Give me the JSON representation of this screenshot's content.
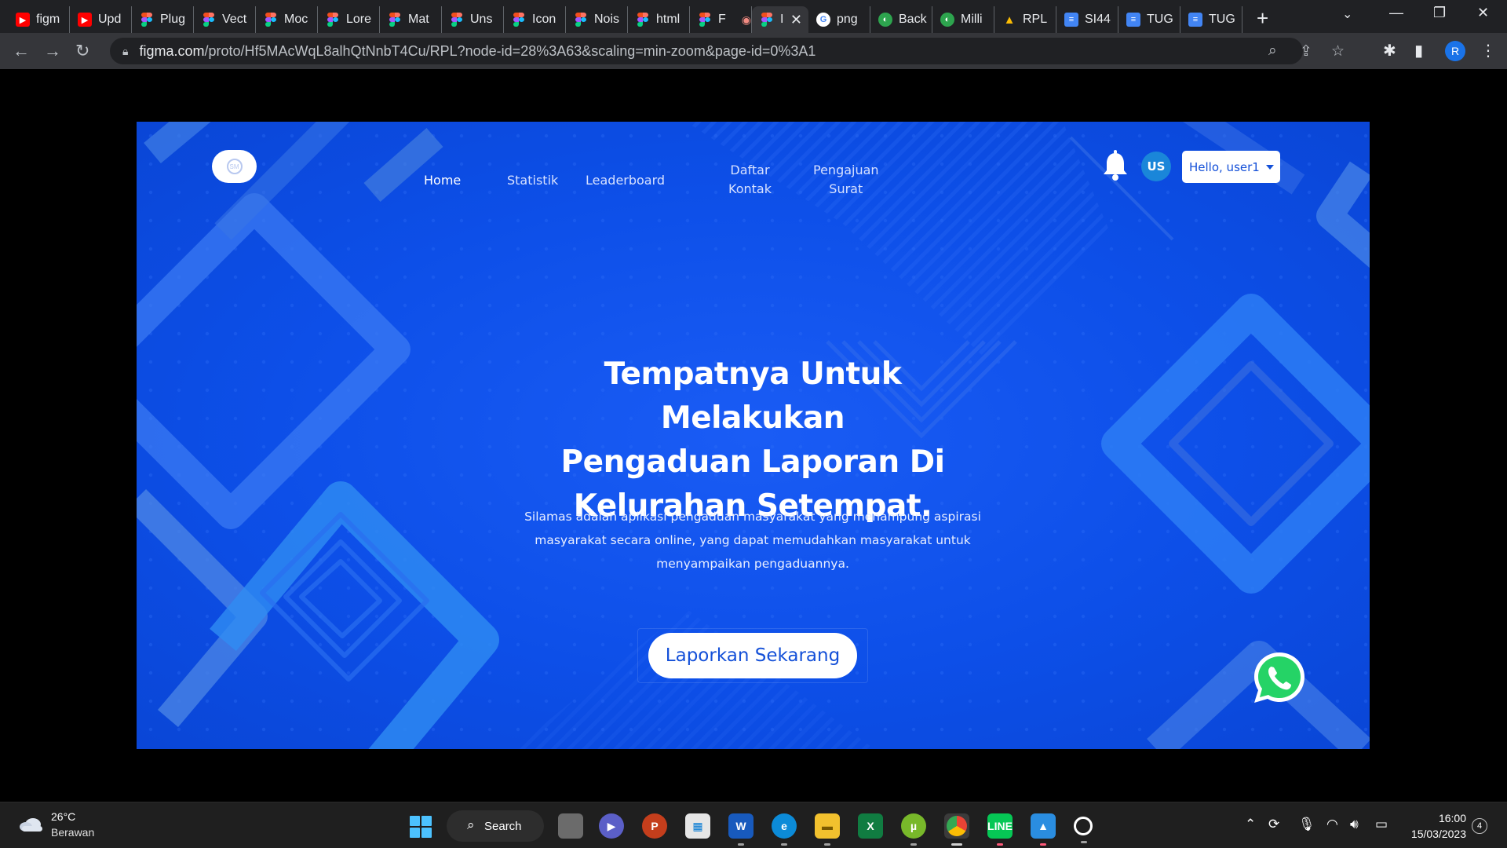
{
  "browser": {
    "tabs": [
      {
        "title": "figm",
        "icon": "youtube-icon"
      },
      {
        "title": "Upd",
        "icon": "youtube-studio-icon"
      },
      {
        "title": "Plug",
        "icon": "figma-icon"
      },
      {
        "title": "Vect",
        "icon": "figma-icon"
      },
      {
        "title": "Moc",
        "icon": "figma-icon"
      },
      {
        "title": "Lore",
        "icon": "figma-icon"
      },
      {
        "title": "Mat",
        "icon": "figma-icon"
      },
      {
        "title": "Uns",
        "icon": "figma-icon"
      },
      {
        "title": "Icon",
        "icon": "figma-icon"
      },
      {
        "title": "Nois",
        "icon": "figma-icon"
      },
      {
        "title": "html",
        "icon": "figma-icon"
      },
      {
        "title": "F",
        "icon": "figma-icon"
      },
      {
        "title": "I",
        "icon": "figma-icon"
      },
      {
        "title": "png",
        "icon": "google-icon"
      },
      {
        "title": "Back",
        "icon": "green-app-icon"
      },
      {
        "title": "Milli",
        "icon": "green-app-icon"
      },
      {
        "title": "RPL",
        "icon": "google-drive-icon"
      },
      {
        "title": "SI44",
        "icon": "google-docs-icon"
      },
      {
        "title": "TUG",
        "icon": "google-docs-icon"
      },
      {
        "title": "TUG",
        "icon": "google-docs-icon"
      }
    ],
    "active_tab_index": 12,
    "url_host": "figma.com",
    "url_path": "/proto/Hf5MAcWqL8alhQtNnbT4Cu/RPL?node-id=28%3A63&scaling=min-zoom&page-id=0%3A1",
    "profile_initial": "R"
  },
  "site": {
    "nav": {
      "home": "Home",
      "statistik": "Statistik",
      "leaderboard": "Leaderboard",
      "daftar_kontak_1": "Daftar",
      "daftar_kontak_2": "Kontak",
      "pengajuan_surat_1": "Pengajuan",
      "pengajuan_surat_2": "Surat"
    },
    "avatar_initials": "US",
    "user_greeting": "Hello, user1",
    "hero": {
      "title_line1": "Tempatnya Untuk Melakukan",
      "title_line2": "Pengaduan Laporan Di",
      "title_line3": "Kelurahan Setempat.",
      "desc_line1": "Silamas adalah aplikasi pengaduan masyarakat yang menampung aspirasi",
      "desc_line2": "masyarakat secara online, yang dapat memudahkan masyarakat untuk",
      "desc_line3": "menyampaikan pengaduannya."
    },
    "cta_label": "Laporkan Sekarang",
    "colors": {
      "primary": "#0d4fe8",
      "accent_text": "#1450d8",
      "whatsapp": "#25d366"
    }
  },
  "taskbar": {
    "temperature": "26°C",
    "condition": "Berawan",
    "search_label": "Search",
    "time": "16:00",
    "date": "15/03/2023",
    "notification_count": "4"
  }
}
